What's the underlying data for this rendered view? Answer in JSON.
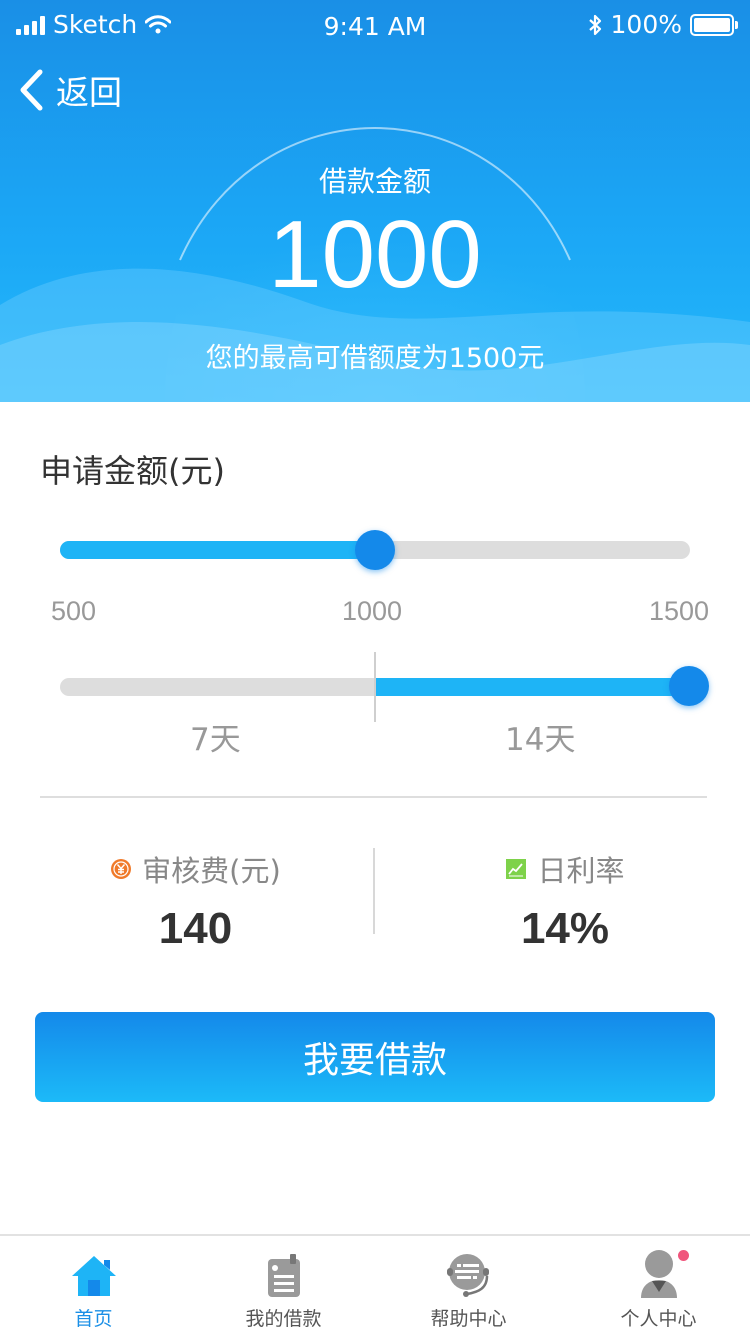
{
  "status_bar": {
    "carrier": "Sketch",
    "time": "9:41 AM",
    "battery": "100%"
  },
  "nav": {
    "back_label": "返回"
  },
  "hero": {
    "title": "借款金额",
    "amount": "1000",
    "max_note": "您的最高可借额度为1500元"
  },
  "apply": {
    "title": "申请金额(元)",
    "slider": {
      "min": 500,
      "max": 1500,
      "value": 1000,
      "ticks": [
        "500",
        "1000",
        "1500"
      ]
    },
    "term": {
      "options": [
        "7天",
        "14天"
      ],
      "selected": "14天"
    }
  },
  "stats": {
    "fee": {
      "label": "审核费(元)",
      "value": "140",
      "icon": "yuan-coin-icon",
      "color": "#f07a2a"
    },
    "rate": {
      "label": "日利率",
      "value": "14%",
      "icon": "trend-chart-icon",
      "color": "#7ed24a"
    }
  },
  "cta": {
    "label": "我要借款"
  },
  "colors": {
    "primary": "#1489ea",
    "accent": "#1eb4f6",
    "badge": "#f0557c"
  },
  "tabs": [
    {
      "label": "首页",
      "icon": "home-icon",
      "active": true
    },
    {
      "label": "我的借款",
      "icon": "clipboard-icon",
      "active": false
    },
    {
      "label": "帮助中心",
      "icon": "help-headset-icon",
      "active": false
    },
    {
      "label": "个人中心",
      "icon": "user-icon",
      "active": false,
      "badge": true
    }
  ]
}
